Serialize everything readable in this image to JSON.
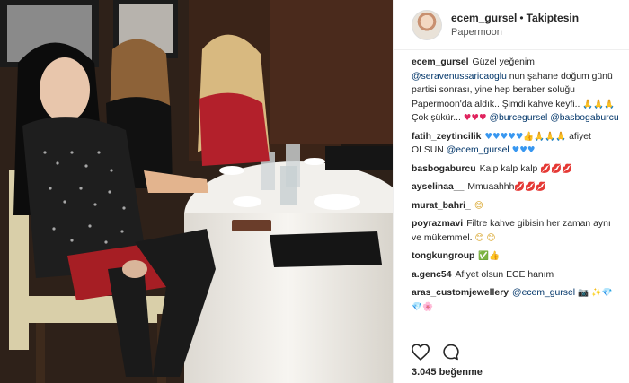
{
  "header": {
    "username": "ecem_gursel",
    "separator": "•",
    "follow_status": "Takiptesin",
    "location": "Papermoon"
  },
  "comments": [
    {
      "user": "ecem_gursel",
      "parts": [
        {
          "t": "Güzel yeğenim "
        },
        {
          "t": "@seravenussaricaoglu",
          "m": true
        },
        {
          "t": " nun şahane doğum günü partisi sonrası, yine hep beraber soluğu Papermoon'da aldık.. Şimdi kahve keyfi.. "
        },
        {
          "t": "🙏🙏🙏",
          "e": "gold"
        },
        {
          "t": " Çok şükür... "
        },
        {
          "t": "♥♥♥",
          "e": "red"
        },
        {
          "t": " "
        },
        {
          "t": "@burcegursel",
          "m": true
        },
        {
          "t": " "
        },
        {
          "t": "@basbogaburcu",
          "m": true
        }
      ]
    },
    {
      "user": "fatih_zeytincilik",
      "parts": [
        {
          "t": "♥♥♥♥♥",
          "e": "blue"
        },
        {
          "t": "👍🙏🙏",
          "e": "gold"
        },
        {
          "t": "🙏",
          "e": "gold"
        },
        {
          "t": " afiyet OLSUN "
        },
        {
          "t": "@ecem_gursel",
          "m": true
        },
        {
          "t": " "
        },
        {
          "t": "♥♥♥",
          "e": "blue"
        }
      ]
    },
    {
      "user": "basbogaburcu",
      "parts": [
        {
          "t": "Kalp kalp kalp "
        },
        {
          "t": "💋💋💋",
          "e": "red"
        }
      ]
    },
    {
      "user": "ayselinaa__",
      "parts": [
        {
          "t": "Mmuaahhh"
        },
        {
          "t": "💋💋💋",
          "e": "red"
        }
      ]
    },
    {
      "user": "murat_bahri_",
      "parts": [
        {
          "t": "😊",
          "e": "gold"
        }
      ]
    },
    {
      "user": "poyrazmavi",
      "parts": [
        {
          "t": "Filtre kahve gibisin her zaman aynı ve mükemmel. "
        },
        {
          "t": "😊 😊",
          "e": "gold"
        }
      ]
    },
    {
      "user": "tongkungroup",
      "parts": [
        {
          "t": "✅",
          "e": "green"
        },
        {
          "t": "👍",
          "e": "gold"
        }
      ]
    },
    {
      "user": "a.genc54",
      "parts": [
        {
          "t": "Afiyet olsun ECE hanım"
        }
      ]
    },
    {
      "user": "aras_customjewellery",
      "parts": [
        {
          "t": "@ecem_gursel",
          "m": true
        },
        {
          "t": " "
        },
        {
          "t": "📷",
          "e": "gray"
        },
        {
          "t": " ✨💎💎",
          "e": "blue"
        },
        {
          "t": "🌸",
          "e": "red"
        }
      ]
    }
  ],
  "actions": {
    "like_icon": "heart-outline-icon",
    "comment_icon": "speech-bubble-icon"
  },
  "likes_text": "3.045 beğenme",
  "colors": {
    "mention": "#003569",
    "border": "#efefef",
    "text": "#262626"
  }
}
